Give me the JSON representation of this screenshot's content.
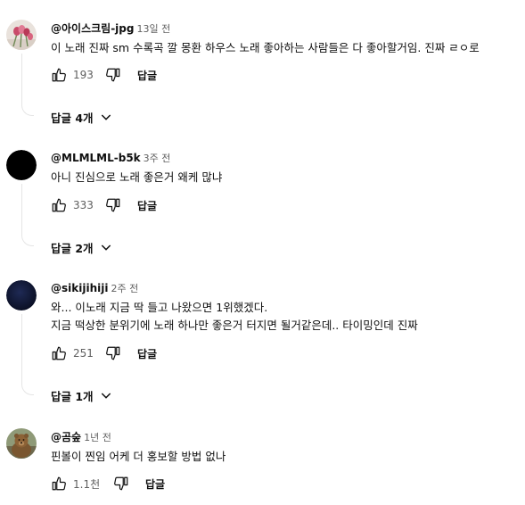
{
  "comments": [
    {
      "author": "@아이스크림-jpg",
      "time": "13일 전",
      "text": "이 노래 진짜 sm 수록곡 깔 몽환 하우스 노래 좋아하는 사람들은 다 좋아할거임. 진짜 ㄹㅇ로",
      "likes": "193",
      "reply_label": "답글",
      "replies_label": "답글 4개",
      "avatar_icon": "tulip-flowers-avatar"
    },
    {
      "author": "@MLMLML-b5k",
      "time": "3주 전",
      "text": "아니 진심으로 노래 좋은거 왜케 많냐",
      "likes": "333",
      "reply_label": "답글",
      "replies_label": "답글 2개",
      "avatar_icon": "black-circle-avatar"
    },
    {
      "author": "@sikijihiji",
      "time": "2주 전",
      "text_line1": "와... 이노래 지금 딱 들고 나왔으면 1위했겠다.",
      "text_line2": "지금 떡상한 분위기에 노래 하나만 좋은거 터지면 될거같은데.. 타이밍인데 진짜",
      "likes": "251",
      "reply_label": "답글",
      "replies_label": "답글 1개",
      "avatar_icon": "dark-navy-avatar"
    },
    {
      "author": "@곰숲",
      "time": "1년 전",
      "text": "핀볼이 찐임 어케 더 홍보할 방법 없나",
      "likes": "1.1천",
      "reply_label": "답글",
      "avatar_icon": "bear-avatar"
    }
  ],
  "colors": {
    "text_primary": "#0f0f0f",
    "text_secondary": "#606060",
    "thread_line": "#e5e5e5"
  }
}
